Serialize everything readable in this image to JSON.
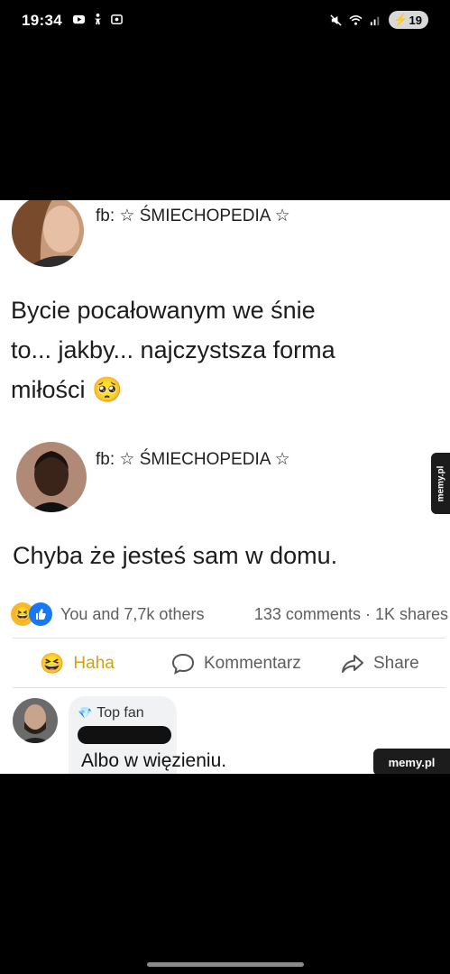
{
  "status_bar": {
    "time": "19:34",
    "battery": "19",
    "icons": [
      "youtube-icon",
      "accessibility-icon",
      "screenshot-icon",
      "mute-icon",
      "wifi-icon",
      "signal-icon",
      "battery-icon"
    ]
  },
  "post1": {
    "page_name": "fb: ☆ ŚMIECHOPEDIA ☆",
    "lines": [
      "Bycie pocałowanym we śnie",
      "to... jakby... najczystsza forma",
      "miłości 🥺"
    ]
  },
  "post2": {
    "page_name": "fb: ☆ ŚMIECHOPEDIA ☆",
    "text": "Chyba że jesteś sam w domu."
  },
  "reactions": {
    "likes": "You and 7,7k others",
    "comments_shares": "133 comments · 1K shares"
  },
  "actions": {
    "haha": "Haha",
    "comment": "Kommentarz",
    "share": "Share"
  },
  "comment": {
    "badge": "Top fan",
    "text": "Albo w więzieniu."
  },
  "watermarks": {
    "bottom": "memy.pl",
    "side": "memy.pl"
  },
  "colors": {
    "background": "#000000",
    "card": "#ffffff",
    "like_blue": "#1877f2",
    "haha_yellow": "#f7b928"
  }
}
